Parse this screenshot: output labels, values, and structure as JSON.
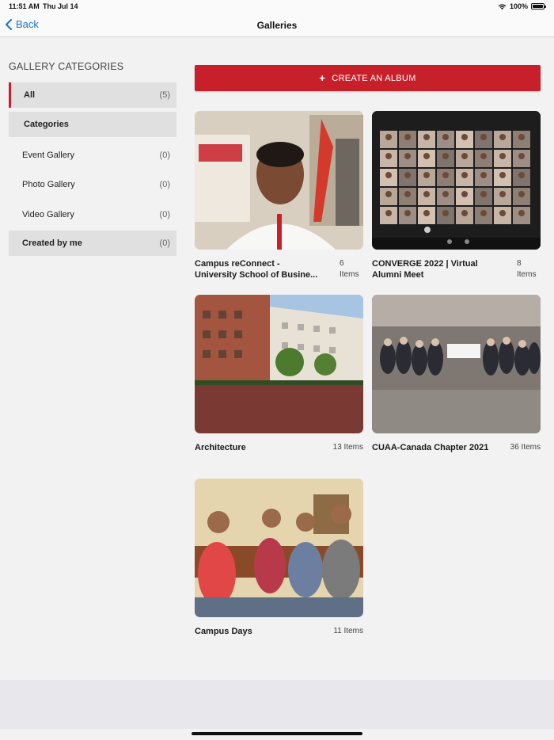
{
  "status_bar": {
    "time": "11:51 AM",
    "date": "Thu Jul 14",
    "battery": "100%",
    "wifi_icon": "wifi-icon",
    "battery_icon": "battery-icon"
  },
  "nav": {
    "back_label": "Back",
    "title": "Galleries"
  },
  "sidebar": {
    "heading": "GALLERY CATEGORIES",
    "items": [
      {
        "label": "All",
        "count": "(5)"
      },
      {
        "label": "Categories",
        "count": ""
      },
      {
        "label": "Event Gallery",
        "count": "(0)"
      },
      {
        "label": "Photo Gallery",
        "count": "(0)"
      },
      {
        "label": "Video Gallery",
        "count": "(0)"
      },
      {
        "label": "Created by me",
        "count": "(0)"
      }
    ]
  },
  "create_button": {
    "icon": "+",
    "label": "CREATE AN ALBUM"
  },
  "albums": [
    {
      "title": "Campus reConnect - University School of Busine...",
      "count": "6 Items"
    },
    {
      "title": "CONVERGE 2022 | Virtual Alumni Meet",
      "count": "8 Items"
    },
    {
      "title": "Architecture",
      "count": "13 Items"
    },
    {
      "title": "CUAA-Canada Chapter 2021",
      "count": "36 Items"
    },
    {
      "title": "Campus Days",
      "count": "11 Items"
    }
  ],
  "colors": {
    "accent": "#c8202a",
    "link": "#1a73d9",
    "background": "#f2f2f2"
  }
}
